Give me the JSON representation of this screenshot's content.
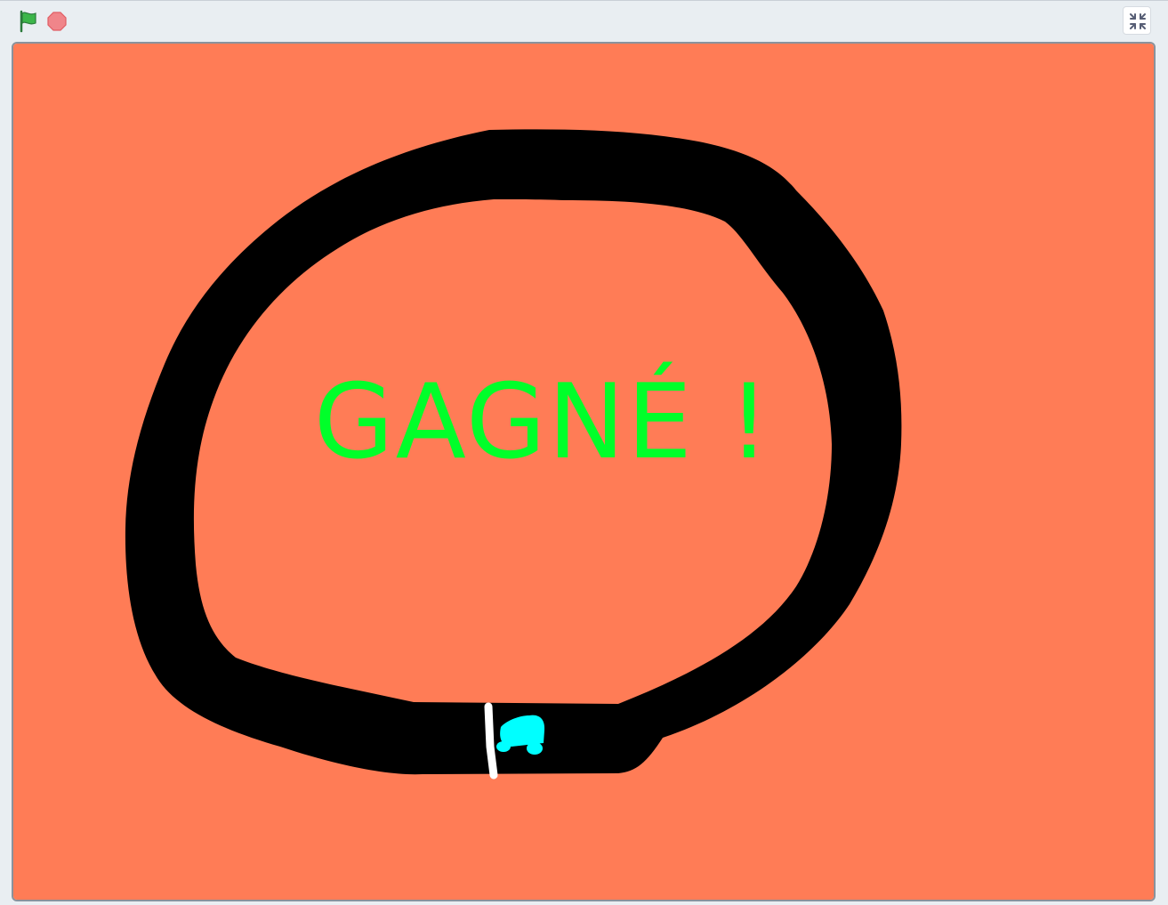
{
  "toolbar": {
    "green_flag_icon": "green-flag-icon",
    "stop_icon": "stop-sign-icon",
    "fullscreen_icon": "exit-fullscreen-icon"
  },
  "stage": {
    "message": "GAGNÉ !",
    "colors": {
      "background": "#ff7c56",
      "track": "#000000",
      "finish_line": "#ffffff",
      "car": "#00ffff",
      "message": "#00ff2a"
    },
    "sprites": [
      "race-track",
      "finish-line",
      "car"
    ]
  }
}
